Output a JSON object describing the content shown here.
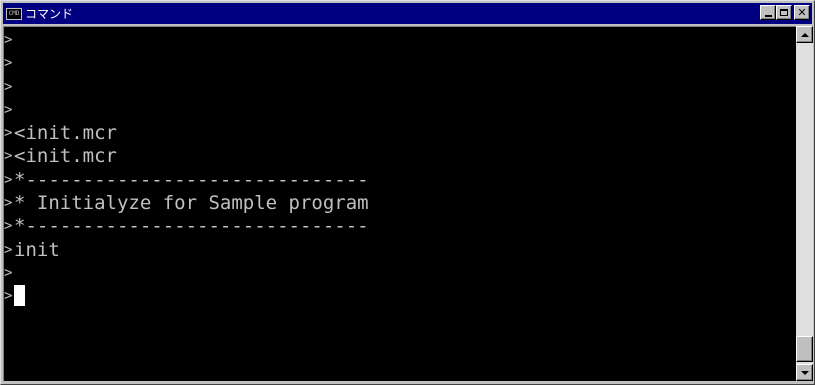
{
  "window": {
    "title": "コマンド",
    "icon_label": "CMD",
    "close_glyph": "✕",
    "colors": {
      "titlebar": "#000080",
      "console_bg": "#000000",
      "console_text": "#c0c0c0",
      "chrome": "#c0c0c0"
    }
  },
  "console": {
    "lines": [
      {
        "prompt": ">",
        "text": ""
      },
      {
        "prompt": ">",
        "text": ""
      },
      {
        "prompt": ">",
        "text": ""
      },
      {
        "prompt": ">",
        "text": ""
      },
      {
        "prompt": ">",
        "text": "<init.mcr"
      },
      {
        "prompt": ">",
        "text": "<init.mcr"
      },
      {
        "prompt": ">",
        "text": "*------------------------------"
      },
      {
        "prompt": ">",
        "text": "* Initialyze for Sample program"
      },
      {
        "prompt": ">",
        "text": "*------------------------------"
      },
      {
        "prompt": ">",
        "text": "init"
      },
      {
        "prompt": ">",
        "text": ""
      },
      {
        "prompt": ">",
        "text": "",
        "cursor": true
      }
    ]
  },
  "icons": {
    "minimize": "minimize-icon",
    "maximize": "maximize-icon",
    "close": "close-icon",
    "scroll_up": "triangle-up-icon",
    "scroll_down": "triangle-down-icon"
  }
}
